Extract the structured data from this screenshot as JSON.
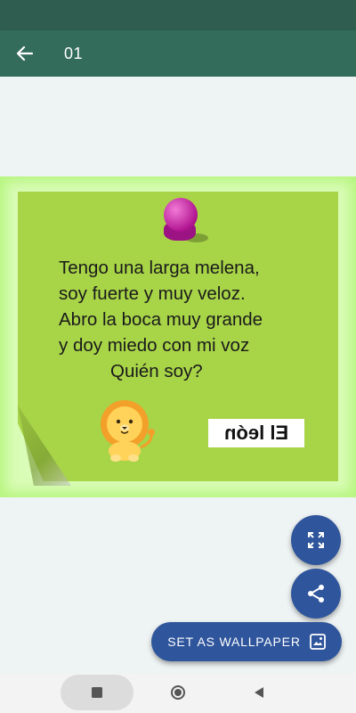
{
  "app_bar": {
    "title": "01",
    "back_icon": "arrow-left-icon",
    "color": "#336c5a"
  },
  "status_bar": {
    "color": "#2f5d4f"
  },
  "image": {
    "riddle_lines": [
      "Tengo una larga melena,",
      "soy fuerte y muy veloz.",
      "Abro la boca muy grande",
      "y doy miedo con mi voz",
      "Quién soy?"
    ],
    "answer": "El león",
    "note_color": "#a8d448",
    "pin_color": "#c81ca3",
    "illustration": "lion-cartoon"
  },
  "actions": {
    "fullscreen_icon": "fullscreen-icon",
    "share_icon": "share-icon",
    "wallpaper_label": "SET AS WALLPAPER",
    "wallpaper_icon": "wallpaper-icon",
    "accent": "#2f559c"
  },
  "nav": {
    "recents_icon": "square-icon",
    "home_icon": "circle-icon",
    "back_icon": "triangle-back-icon"
  }
}
